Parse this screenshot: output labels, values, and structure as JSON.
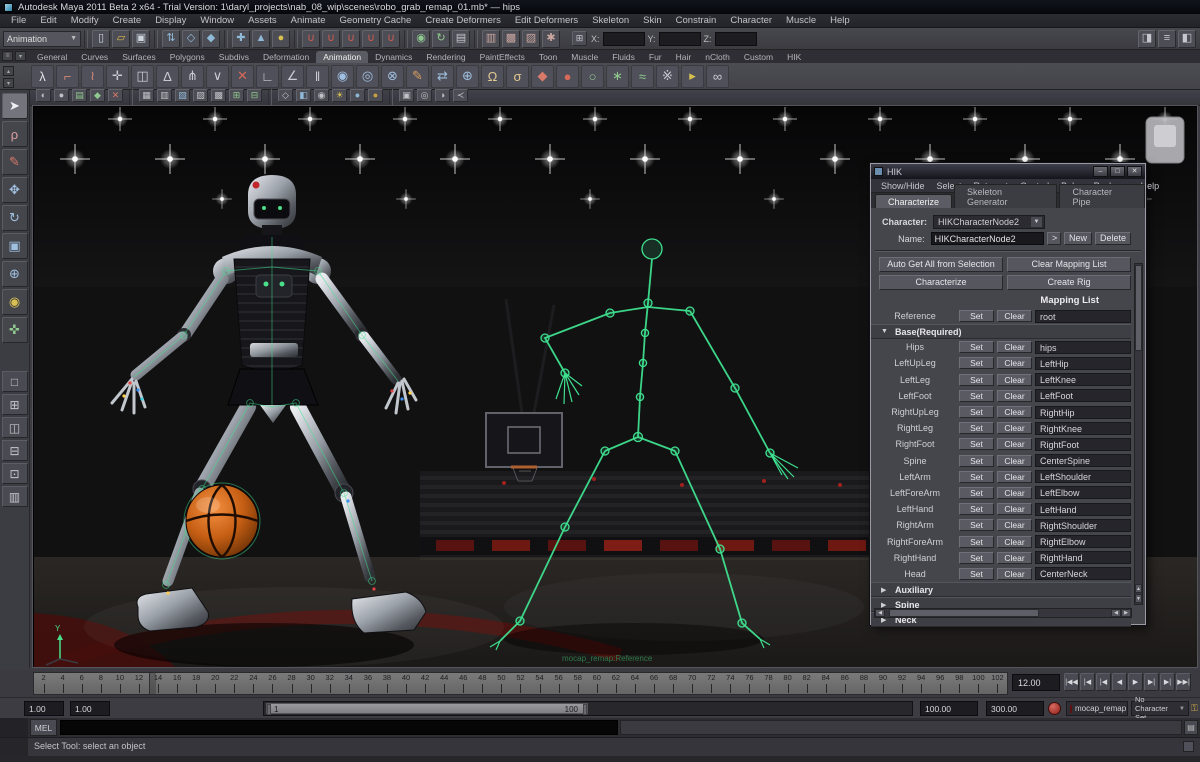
{
  "colors": {
    "skeleton_green": "#3fe08f",
    "basketball_orange": "#d4671d",
    "active_tab_bg": "#5b5b63",
    "snap_red": "#cf5a52"
  },
  "window": {
    "title": "Autodesk Maya 2011 Beta 2 x64 - Trial Version: 1\\daryl_projects\\nab_08_wip\\scenes\\robo_grab_remap_01.mb*  —  hips"
  },
  "menu_bar": [
    "File",
    "Edit",
    "Modify",
    "Create",
    "Display",
    "Window",
    "Assets",
    "Animate",
    "Geometry Cache",
    "Create Deformers",
    "Edit Deformers",
    "Skeleton",
    "Skin",
    "Constrain",
    "Character",
    "Muscle",
    "Help"
  ],
  "status_line": {
    "menu_set": "Animation",
    "coord_labels": [
      "X:",
      "Y:",
      "Z:"
    ],
    "icons": [
      {
        "n": "new-scene-icon",
        "g": "▯",
        "c": "#ccd4dc"
      },
      {
        "n": "open-scene-icon",
        "g": "▱",
        "c": "#d9b44a"
      },
      {
        "n": "save-scene-icon",
        "g": "▣",
        "c": "#ccd4dc"
      },
      {
        "n": "sep"
      },
      {
        "n": "select-by-hierarchy-icon",
        "g": "⇅",
        "c": "#8fb9d6"
      },
      {
        "n": "select-by-object-icon",
        "g": "◇",
        "c": "#8fb9d6"
      },
      {
        "n": "select-by-component-icon",
        "g": "◆",
        "c": "#8fb9d6"
      },
      {
        "n": "sep"
      },
      {
        "n": "highlight-selection-icon",
        "g": "✚",
        "c": "#8fb9d6"
      },
      {
        "n": "select-move-icon",
        "g": "▲",
        "c": "#8fb9d6"
      },
      {
        "n": "lock-selection-icon",
        "g": "●",
        "c": "#d8c050"
      },
      {
        "n": "sep"
      },
      {
        "n": "snap-to-grid-icon",
        "g": "∪",
        "c": "#cf5a52"
      },
      {
        "n": "snap-to-curve-icon",
        "g": "∪",
        "c": "#cf5a52"
      },
      {
        "n": "snap-to-point-icon",
        "g": "∪",
        "c": "#cf5a52"
      },
      {
        "n": "snap-to-plane-icon",
        "g": "∪",
        "c": "#cf5a52"
      },
      {
        "n": "snap-to-view-icon",
        "g": "∪",
        "c": "#cf5a52"
      },
      {
        "n": "sep"
      },
      {
        "n": "make-live-icon",
        "g": "◉",
        "c": "#8fc98f"
      },
      {
        "n": "construction-history-icon",
        "g": "↻",
        "c": "#8fc98f"
      },
      {
        "n": "clipboard-icon",
        "g": "▤",
        "c": "#c6c6cc"
      },
      {
        "n": "sep"
      },
      {
        "n": "render-view-icon",
        "g": "▥",
        "c": "#c9a6a0"
      },
      {
        "n": "render-current-frame-icon",
        "g": "▩",
        "c": "#c9a6a0"
      },
      {
        "n": "ipr-render-icon",
        "g": "▨",
        "c": "#c9a6a0"
      },
      {
        "n": "render-settings-icon",
        "g": "✱",
        "c": "#c9a6a0"
      }
    ],
    "right_icons": [
      {
        "n": "show-attribute-editor-icon",
        "g": "◨",
        "c": "#c6c6cc"
      },
      {
        "n": "show-tool-settings-icon",
        "g": "≡",
        "c": "#c6c6cc"
      },
      {
        "n": "show-channel-box-icon",
        "g": "◧",
        "c": "#c6c6cc"
      }
    ]
  },
  "shelf": {
    "tabs": [
      "General",
      "Curves",
      "Surfaces",
      "Polygons",
      "Subdivs",
      "Deformation",
      "Animation",
      "Dynamics",
      "Rendering",
      "PaintEffects",
      "Toon",
      "Muscle",
      "Fluids",
      "Fur",
      "Hair",
      "nCloth",
      "Custom",
      "HIK"
    ],
    "active_tab": "Animation",
    "icons": [
      {
        "n": "joint-tool-icon",
        "g": "λ",
        "c": "#e0e0e4"
      },
      {
        "n": "ik-handle-tool-icon",
        "g": "⌐",
        "c": "#d88a7a"
      },
      {
        "n": "ik-spline-tool-icon",
        "g": "≀",
        "c": "#d88a7a"
      },
      {
        "n": "insert-joint-icon",
        "g": "✛",
        "c": "#c8ccd2"
      },
      {
        "n": "mirror-joint-icon",
        "g": "◫",
        "c": "#c8ccd2"
      },
      {
        "n": "orient-joint-icon",
        "g": "Δ",
        "c": "#c8ccd2"
      },
      {
        "n": "rebuild-skeleton-icon",
        "g": "⋔",
        "c": "#c8ccd2"
      },
      {
        "n": "connect-joint-icon",
        "g": "∨",
        "c": "#c8ccd2"
      },
      {
        "n": "disconnect-joint-icon",
        "g": "✕",
        "c": "#d86a5a"
      },
      {
        "n": "set-preferred-angle-icon",
        "g": "∟",
        "c": "#c8ccd2"
      },
      {
        "n": "assume-preferred-angle-icon",
        "g": "∠",
        "c": "#c8ccd2"
      },
      {
        "n": "ik-fk-blend-icon",
        "g": "‖",
        "c": "#c8ccd2"
      },
      {
        "n": "smooth-bind-icon",
        "g": "◉",
        "c": "#9fc0e0"
      },
      {
        "n": "rigid-bind-icon",
        "g": "◎",
        "c": "#9fc0e0"
      },
      {
        "n": "detach-skin-icon",
        "g": "⊗",
        "c": "#9fc0e0"
      },
      {
        "n": "paint-weights-icon",
        "g": "✎",
        "c": "#d8a060"
      },
      {
        "n": "mirror-weights-icon",
        "g": "⇄",
        "c": "#9fc0e0"
      },
      {
        "n": "copy-weights-icon",
        "g": "⊕",
        "c": "#9fc0e0"
      },
      {
        "n": "full-body-ik-icon",
        "g": "Ω",
        "c": "#e0c890"
      },
      {
        "n": "add-fbik-effector-icon",
        "g": "σ",
        "c": "#e0c890"
      },
      {
        "n": "character-set-icon",
        "g": "◆",
        "c": "#d87a6a"
      },
      {
        "n": "set-key-icon",
        "g": "●",
        "c": "#d86a5a"
      },
      {
        "n": "set-breakdown-icon",
        "g": "○",
        "c": "#8fc98f"
      },
      {
        "n": "hold-current-keys-icon",
        "g": "∗",
        "c": "#8fc98f"
      },
      {
        "n": "motion-trail-icon",
        "g": "≈",
        "c": "#8fc98f"
      },
      {
        "n": "ghost-selected-icon",
        "g": "※",
        "c": "#c8ccd2"
      },
      {
        "n": "create-clip-icon",
        "g": "▸",
        "c": "#d8c050"
      },
      {
        "n": "blend-shape-icon",
        "g": "∞",
        "c": "#c8ccd2"
      }
    ]
  },
  "viewport_bar_icons": [
    {
      "n": "select-camera-icon",
      "g": "◐",
      "c": "#c0c0c6"
    },
    {
      "n": "lock-camera-icon",
      "g": "●",
      "c": "#c0c0c6"
    },
    {
      "n": "camera-attributes-icon",
      "g": "▤",
      "c": "#8fc98f"
    },
    {
      "n": "bookmark-icon",
      "g": "◆",
      "c": "#8fc98f"
    },
    {
      "n": "image-plane-icon",
      "g": "✕",
      "c": "#d87a6a"
    },
    {
      "n": "sep"
    },
    {
      "n": "grid-toggle-icon",
      "g": "▦",
      "c": "#c0c0c6"
    },
    {
      "n": "film-gate-icon",
      "g": "▥",
      "c": "#c0c0c6"
    },
    {
      "n": "resolution-gate-icon",
      "g": "▧",
      "c": "#8fb9d6"
    },
    {
      "n": "gate-mask-icon",
      "g": "▨",
      "c": "#c0c0c6"
    },
    {
      "n": "field-chart-icon",
      "g": "▩",
      "c": "#c0c0c6"
    },
    {
      "n": "safe-action-icon",
      "g": "⊞",
      "c": "#8fc98f"
    },
    {
      "n": "safe-title-icon",
      "g": "⊟",
      "c": "#8fc98f"
    },
    {
      "n": "sep"
    },
    {
      "n": "wireframe-icon",
      "g": "◇",
      "c": "#c0c0c6"
    },
    {
      "n": "shaded-icon",
      "g": "◧",
      "c": "#8fb9d6"
    },
    {
      "n": "textured-icon",
      "g": "◉",
      "c": "#c0c0c6"
    },
    {
      "n": "lights-icon",
      "g": "☀",
      "c": "#d8c050"
    },
    {
      "n": "shadows-icon",
      "g": "●",
      "c": "#8fb9d6"
    },
    {
      "n": "ambient-occlusion-icon",
      "g": "●",
      "c": "#c8a040"
    },
    {
      "n": "sep"
    },
    {
      "n": "isolate-select-icon",
      "g": "▣",
      "c": "#c0c0c6"
    },
    {
      "n": "xray-icon",
      "g": "◎",
      "c": "#c0c0c6"
    },
    {
      "n": "xray-joints-icon",
      "g": "◑",
      "c": "#c0c0c6"
    },
    {
      "n": "separations-icon",
      "g": "≺",
      "c": "#c0c0c6"
    }
  ],
  "tool_box": {
    "tools": [
      {
        "n": "select-tool",
        "g": "➤",
        "c": "#f0f0f4",
        "active": true
      },
      {
        "n": "lasso-select-tool",
        "g": "ρ",
        "c": "#d8a0a0"
      },
      {
        "n": "paint-select-tool",
        "g": "✎",
        "c": "#d87a6a"
      },
      {
        "n": "move-tool",
        "g": "✥",
        "c": "#9fc0e0"
      },
      {
        "n": "rotate-tool",
        "g": "↻",
        "c": "#9fc0e0"
      },
      {
        "n": "scale-tool",
        "g": "▣",
        "c": "#9fc0e0"
      },
      {
        "n": "universal-manipulator-tool",
        "g": "⊕",
        "c": "#9fc0e0"
      },
      {
        "n": "soft-modification-tool",
        "g": "◉",
        "c": "#d8c050"
      },
      {
        "n": "show-manipulator-tool",
        "g": "✜",
        "c": "#8fc98f"
      }
    ],
    "layouts": [
      {
        "n": "single-pane-layout-button",
        "g": "□"
      },
      {
        "n": "four-pane-layout-button",
        "g": "⊞"
      },
      {
        "n": "persp-outliner-layout-button",
        "g": "◫"
      },
      {
        "n": "persp-graph-layout-button",
        "g": "⊟"
      },
      {
        "n": "hypershade-persp-layout-button",
        "g": "⊡"
      },
      {
        "n": "persp-uv-layout-button",
        "g": "▥"
      }
    ]
  },
  "hik": {
    "title": "HIK",
    "window_buttons": [
      "–",
      "□",
      "✕"
    ],
    "menus": [
      "Show/Hide",
      "Select",
      "Retarget",
      "Control Rig",
      "Bake",
      "Package",
      "Help"
    ],
    "tabs": [
      "Characterize",
      "Skeleton Generator",
      "Character Pipe"
    ],
    "active_tab": "Characterize",
    "character_label": "Character:",
    "character_value": "HIKCharacterNode2",
    "name_label": "Name:",
    "name_value": "HIKCharacterNode2",
    "expand_button": ">",
    "new_button": "New",
    "delete_button": "Delete",
    "action_buttons": [
      "Auto Get All from Selection",
      "Clear Mapping List",
      "Characterize",
      "Create Rig"
    ],
    "mapping_list_title": "Mapping List",
    "set_label": "Set",
    "clear_label": "Clear",
    "reference_row": {
      "label": "Reference",
      "value": "root"
    },
    "base_section": {
      "label": "Base(Required)",
      "rows": [
        {
          "label": "Hips",
          "value": "hips"
        },
        {
          "label": "LeftUpLeg",
          "value": "LeftHip"
        },
        {
          "label": "LeftLeg",
          "value": "LeftKnee"
        },
        {
          "label": "LeftFoot",
          "value": "LeftFoot"
        },
        {
          "label": "RightUpLeg",
          "value": "RightHip"
        },
        {
          "label": "RightLeg",
          "value": "RightKnee"
        },
        {
          "label": "RightFoot",
          "value": "RightFoot"
        },
        {
          "label": "Spine",
          "value": "CenterSpine"
        },
        {
          "label": "LeftArm",
          "value": "LeftShoulder"
        },
        {
          "label": "LeftForeArm",
          "value": "LeftElbow"
        },
        {
          "label": "LeftHand",
          "value": "LeftHand"
        },
        {
          "label": "RightArm",
          "value": "RightShoulder"
        },
        {
          "label": "RightForeArm",
          "value": "RightElbow"
        },
        {
          "label": "RightHand",
          "value": "RightHand"
        },
        {
          "label": "Head",
          "value": "CenterNeck"
        }
      ]
    },
    "collapsed_sections": [
      "Auxiliary",
      "Spine",
      "Neck"
    ]
  },
  "timeline": {
    "start": 2,
    "end": 102,
    "step": 2,
    "current_frame": "12.00",
    "playhead_frame": 12
  },
  "playback_buttons": [
    {
      "n": "go-to-start-button",
      "g": "|◀◀"
    },
    {
      "n": "step-back-frame-button",
      "g": "|◀"
    },
    {
      "n": "step-back-key-button",
      "g": "|◀"
    },
    {
      "n": "play-backwards-button",
      "g": "◀"
    },
    {
      "n": "play-forwards-button",
      "g": "▶"
    },
    {
      "n": "step-forward-key-button",
      "g": "▶|"
    },
    {
      "n": "step-forward-frame-button",
      "g": "▶|"
    },
    {
      "n": "go-to-end-button",
      "g": "▶▶|"
    }
  ],
  "range_slider": {
    "anim_start": "1.00",
    "playback_start": "1.00",
    "range_min_label": "1",
    "range_max_label": "100",
    "playback_end": "100.00",
    "anim_end": "300.00"
  },
  "character_menus": {
    "selected_set": "mocap_remap",
    "set_state": "No Character Set"
  },
  "command_line": {
    "label": "MEL"
  },
  "help_line": {
    "text": "Select Tool: select an object"
  },
  "viewport": {
    "selection_label": "mocap_remap:Reference"
  }
}
